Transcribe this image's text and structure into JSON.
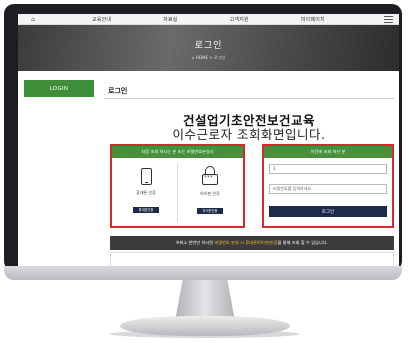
{
  "nav": {
    "items": [
      "교육안내",
      "자료실",
      "고객지원",
      "마이페이지"
    ]
  },
  "hero": {
    "title": "로그인",
    "breadcrumb": "⌂ HOME > 로그인"
  },
  "sidebar": {
    "login_label": "LOGIN"
  },
  "main": {
    "page_title": "로그인",
    "heading1": "건설업기초안전보건교육",
    "heading2": "이수근로자 조회화면입니다."
  },
  "left_panel": {
    "header": "처음 조회 하시는 분 또는 비밀번호분실시",
    "phone_label": "휴대폰 인증",
    "phone_button": "휴대폰인증",
    "ipin_label": "아이핀 인증",
    "ipin_button": "아이핀인증"
  },
  "right_panel": {
    "header": "이전에 조회 하신 분",
    "name_value": "1",
    "password_placeholder": "비밀번호를 입력하세요.",
    "login_button": "로그인"
  },
  "notice": {
    "prefix": "※최소 한번만 하시면",
    "highlight": "비밀번호 분실 시 휴대폰/아이핀인증",
    "suffix": "을 통해 조회 할 수 있습니다."
  },
  "colors": {
    "accent_green": "#4a8f3c",
    "highlight_red": "#d42a2a",
    "button_navy": "#1e2a4a"
  }
}
